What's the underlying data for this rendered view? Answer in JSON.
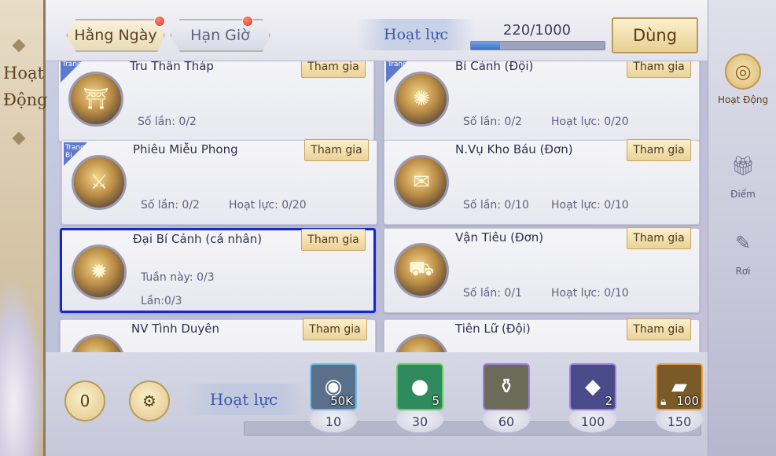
{
  "sidebar_left": {
    "title": "Hoạt\nĐộng"
  },
  "tabs": {
    "daily": "Hằng Ngày",
    "timed": "Hạn Giờ"
  },
  "energy": {
    "label": "Hoạt lực",
    "value_text": "220/1000",
    "fill_fraction": 0.22,
    "use_label": "Dùng"
  },
  "right_nav": [
    {
      "label": "Hoạt Động",
      "icon": "drum-icon",
      "active": true
    },
    {
      "label": "Điểm",
      "icon": "gift-icon",
      "active": false
    },
    {
      "label": "Rơi",
      "icon": "book-icon",
      "active": false
    }
  ],
  "activities": [
    {
      "name": "Tru Thần Tháp",
      "ribbon": "Trang",
      "stats": [
        "Số lần: 0/2",
        ""
      ],
      "join": "Tham gia",
      "icon": "pagoda-icon",
      "icon_glyph": "⛩"
    },
    {
      "name": "Bí Cảnh (Đội)",
      "ribbon": "Trang",
      "stats": [
        "Số lần: 0/2",
        "Hoạt lực: 0/20"
      ],
      "join": "Tham gia",
      "icon": "portal-icon",
      "icon_glyph": "✺"
    },
    {
      "name": "Phiêu Miễu Phong",
      "ribbon": "Trang Bị",
      "stats": [
        "Số lần: 0/2",
        "Hoạt lực: 0/20"
      ],
      "join": "Tham gia",
      "icon": "sword-icon",
      "icon_glyph": "⚔"
    },
    {
      "name": "N.Vụ Kho Báu (Đơn)",
      "ribbon": "",
      "stats": [
        "Số lần: 0/10",
        "Hoạt lực: 0/10"
      ],
      "join": "Tham gia",
      "icon": "map-scroll-icon",
      "icon_glyph": "✉"
    },
    {
      "name": "Đại Bí Cảnh (cá nhân)",
      "ribbon": "",
      "stats": [
        "Tuần này: 0/3",
        "Lần:0/3"
      ],
      "join": "Tham gia",
      "icon": "swirl-portal-icon",
      "icon_glyph": "✹"
    },
    {
      "name": "Vận Tiêu (Đơn)",
      "ribbon": "",
      "stats": [
        "Số lần: 0/1",
        "Hoạt lực: 0/10"
      ],
      "join": "Tham gia",
      "icon": "cart-icon",
      "icon_glyph": "⛟"
    },
    {
      "name": "NV Tình Duyên",
      "ribbon": "",
      "stats": [
        "",
        ""
      ],
      "join": "Tham gia",
      "icon": "lantern-icon",
      "icon_glyph": "❀"
    },
    {
      "name": "Tiên Lữ (Đội)",
      "ribbon": "",
      "stats": [
        "",
        ""
      ],
      "join": "Tham gia",
      "icon": "lantern-icon",
      "icon_glyph": "❀"
    }
  ],
  "bottom": {
    "counter": "0",
    "label": "Hoạt lực",
    "progress_fraction": 0.0,
    "rewards": [
      {
        "threshold": "10",
        "count": "50K",
        "icon": "silver-coin-icon",
        "glyph": "◉",
        "bg": "#5a6f8a",
        "border": "#6cc0e6",
        "locked": false
      },
      {
        "threshold": "30",
        "count": "5",
        "icon": "jade-orb-icon",
        "glyph": "●",
        "bg": "#2f8a5e",
        "border": "#66cc66",
        "locked": false
      },
      {
        "threshold": "60",
        "count": "",
        "icon": "cauldron-icon",
        "glyph": "⚱",
        "bg": "#6c6a58",
        "border": "#a67ee0",
        "locked": false
      },
      {
        "threshold": "100",
        "count": "2",
        "icon": "crystal-icon",
        "glyph": "◆",
        "bg": "#4a4c8a",
        "border": "#a67ee0",
        "locked": false
      },
      {
        "threshold": "150",
        "count": "100",
        "icon": "gold-ingot-icon",
        "glyph": "▰",
        "bg": "#7a5a26",
        "border": "#e8a24a",
        "locked": true
      }
    ]
  }
}
